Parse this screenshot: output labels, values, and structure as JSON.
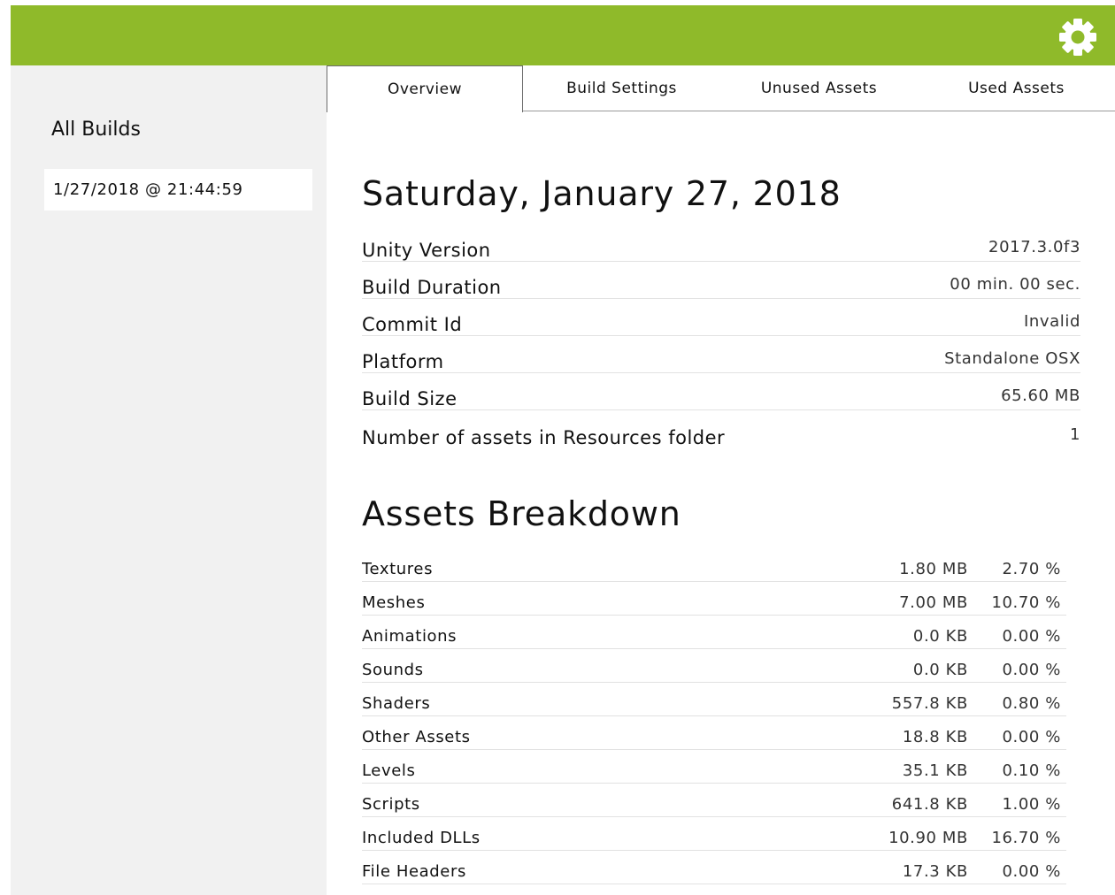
{
  "header": {
    "settings_icon": "gear-icon",
    "color": "#8fba2a"
  },
  "sidebar": {
    "title": "All Builds",
    "builds": [
      "1/27/2018 @ 21:44:59"
    ]
  },
  "tabs": [
    {
      "label": "Overview",
      "active": true
    },
    {
      "label": "Build Settings",
      "active": false
    },
    {
      "label": "Unused Assets",
      "active": false
    },
    {
      "label": "Used Assets",
      "active": false
    }
  ],
  "overview": {
    "date_title": "Saturday, January 27, 2018",
    "info": [
      {
        "label": "Unity Version",
        "value": "2017.3.0f3"
      },
      {
        "label": "Build Duration",
        "value": "00 min. 00 sec."
      },
      {
        "label": "Commit Id",
        "value": "Invalid"
      },
      {
        "label": "Platform",
        "value": "Standalone OSX"
      },
      {
        "label": "Build Size",
        "value": "65.60 MB"
      },
      {
        "label": "Number of assets in Resources folder",
        "value": "1"
      }
    ]
  },
  "assets": {
    "title": "Assets Breakdown",
    "rows": [
      {
        "name": "Textures",
        "size": "1.80 MB",
        "percent": "2.70 %"
      },
      {
        "name": "Meshes",
        "size": "7.00 MB",
        "percent": "10.70 %"
      },
      {
        "name": "Animations",
        "size": "0.0 KB",
        "percent": "0.00 %"
      },
      {
        "name": "Sounds",
        "size": "0.0 KB",
        "percent": "0.00 %"
      },
      {
        "name": "Shaders",
        "size": "557.8 KB",
        "percent": "0.80 %"
      },
      {
        "name": "Other Assets",
        "size": "18.8 KB",
        "percent": "0.00 %"
      },
      {
        "name": "Levels",
        "size": "35.1 KB",
        "percent": "0.10 %"
      },
      {
        "name": "Scripts",
        "size": "641.8 KB",
        "percent": "1.00 %"
      },
      {
        "name": "Included DLLs",
        "size": "10.90 MB",
        "percent": "16.70 %"
      },
      {
        "name": "File Headers",
        "size": "17.3 KB",
        "percent": "0.00 %"
      }
    ]
  }
}
